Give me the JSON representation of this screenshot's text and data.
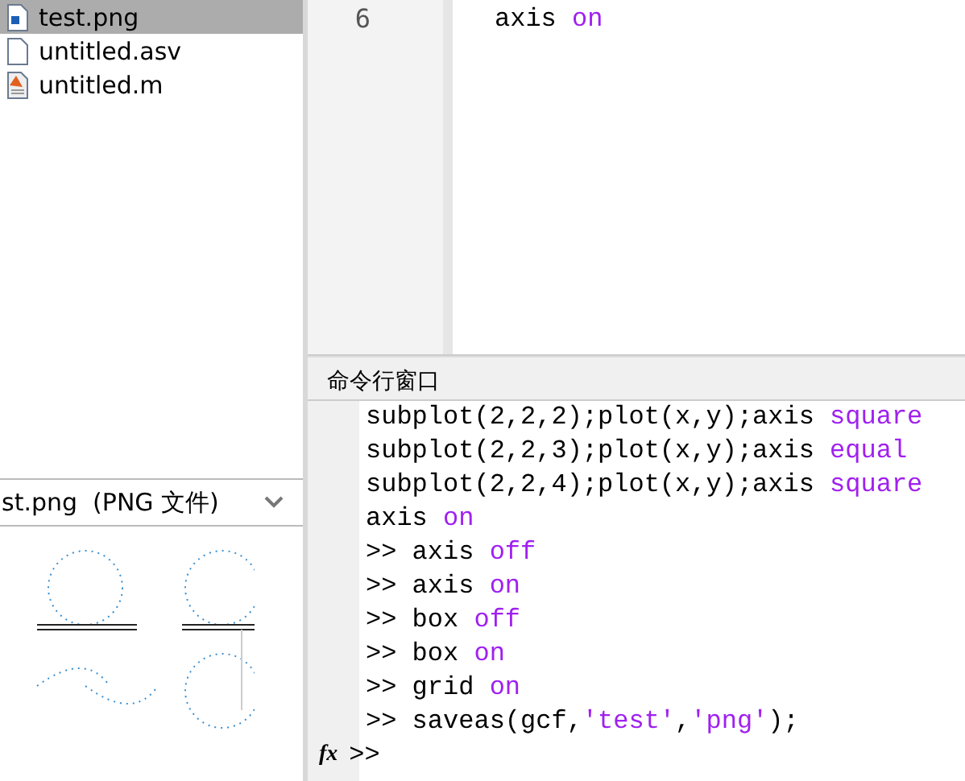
{
  "files": [
    {
      "name": "test.png",
      "kind": "image",
      "selected": true
    },
    {
      "name": "untitled.asv",
      "kind": "blank",
      "selected": false
    },
    {
      "name": "untitled.m",
      "kind": "script",
      "selected": false
    }
  ],
  "preview": {
    "title": "st.png  (PNG 文件)"
  },
  "editor": {
    "lines": [
      {
        "number": "6",
        "segments": [
          {
            "text": "axis ",
            "kind": "code"
          },
          {
            "text": "on",
            "kind": "keyword"
          }
        ]
      }
    ]
  },
  "command_window": {
    "title": "命令行窗口",
    "lines": [
      [
        {
          "text": "subplot(2,2,2);plot(x,y);axis ",
          "kind": "code"
        },
        {
          "text": "square",
          "kind": "keyword"
        }
      ],
      [
        {
          "text": "subplot(2,2,3);plot(x,y);axis ",
          "kind": "code"
        },
        {
          "text": "equal",
          "kind": "keyword"
        }
      ],
      [
        {
          "text": "subplot(2,2,4);plot(x,y);axis ",
          "kind": "code"
        },
        {
          "text": "square",
          "kind": "keyword"
        }
      ],
      [
        {
          "text": "axis ",
          "kind": "code"
        },
        {
          "text": "on",
          "kind": "keyword"
        }
      ],
      [
        {
          "text": ">> axis ",
          "kind": "code"
        },
        {
          "text": "off",
          "kind": "keyword"
        }
      ],
      [
        {
          "text": ">> axis ",
          "kind": "code"
        },
        {
          "text": "on",
          "kind": "keyword"
        }
      ],
      [
        {
          "text": ">> box ",
          "kind": "code"
        },
        {
          "text": "off",
          "kind": "keyword"
        }
      ],
      [
        {
          "text": ">> box ",
          "kind": "code"
        },
        {
          "text": "on",
          "kind": "keyword"
        }
      ],
      [
        {
          "text": ">> grid ",
          "kind": "code"
        },
        {
          "text": "on",
          "kind": "keyword"
        }
      ],
      [
        {
          "text": ">> saveas(gcf,",
          "kind": "code"
        },
        {
          "text": "'test'",
          "kind": "keyword"
        },
        {
          "text": ",",
          "kind": "code"
        },
        {
          "text": "'png'",
          "kind": "keyword"
        },
        {
          "text": ");",
          "kind": "code"
        }
      ]
    ],
    "function_label": "fx",
    "prompt": ">>"
  }
}
